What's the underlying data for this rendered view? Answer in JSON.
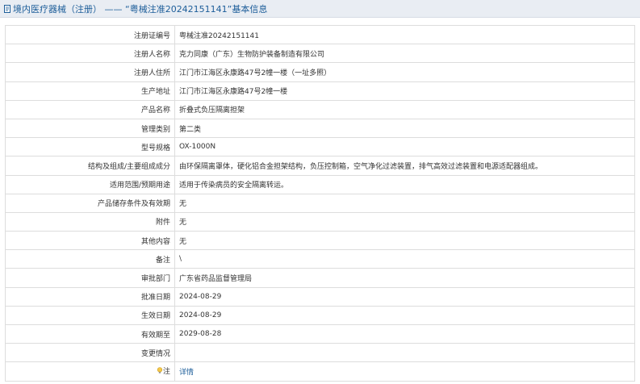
{
  "header": {
    "title": "境内医疗器械（注册） —— “粤械注准20242151141”基本信息"
  },
  "rows": [
    {
      "key": "注册证编号",
      "value": "粤械注准20242151141"
    },
    {
      "key": "注册人名称",
      "value": "克力同康（广东）生物防护装备制造有限公司"
    },
    {
      "key": "注册人住所",
      "value": "江门市江海区永康路47号2幢一楼（一址多照）"
    },
    {
      "key": "生产地址",
      "value": "江门市江海区永康路47号2幢一楼"
    },
    {
      "key": "产品名称",
      "value": "折叠式负压隔离担架"
    },
    {
      "key": "管理类别",
      "value": "第二类"
    },
    {
      "key": "型号规格",
      "value": "OX-1000N"
    },
    {
      "key": "结构及组成/主要组成成分",
      "value": "由环保隔离罩体，硬化铝合金担架结构，负压控制箱，空气净化过滤装置，排气高效过滤装置和电源适配器组成。"
    },
    {
      "key": "适用范围/预期用途",
      "value": "适用于传染病员的安全隔离转运。"
    },
    {
      "key": "产品储存条件及有效期",
      "value": "无"
    },
    {
      "key": "附件",
      "value": "无"
    },
    {
      "key": "其他内容",
      "value": "无"
    },
    {
      "key": "备注",
      "value": "\\"
    },
    {
      "key": "审批部门",
      "value": "广东省药品监督管理局"
    },
    {
      "key": "批准日期",
      "value": "2024-08-29"
    },
    {
      "key": "生效日期",
      "value": "2024-08-29"
    },
    {
      "key": "有效期至",
      "value": "2029-08-28"
    },
    {
      "key": "变更情况",
      "value": ""
    }
  ],
  "note": {
    "key": "注",
    "link": "详情",
    "icon": "lightbulb-icon"
  },
  "colors": {
    "header_bg": "#e9edf3",
    "link": "#1c5d99",
    "border": "#dddddd"
  }
}
